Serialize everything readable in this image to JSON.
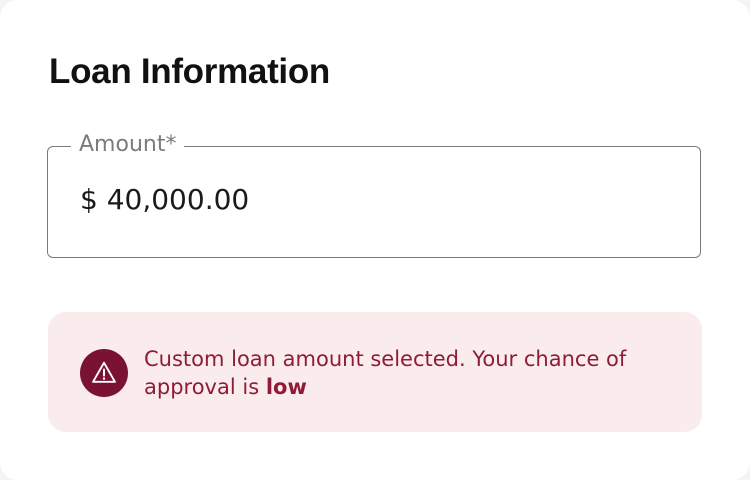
{
  "section": {
    "title": "Loan Information"
  },
  "amount_field": {
    "label": "Amount*",
    "value": "$ 40,000.00"
  },
  "alert": {
    "icon": "warning-triangle-icon",
    "message": "Custom loan amount selected. Your chance of approval is ",
    "emphasis": "low"
  },
  "colors": {
    "alert_background": "#faecec",
    "alert_text": "#8f1c37",
    "alert_icon_background": "#7a1233"
  }
}
